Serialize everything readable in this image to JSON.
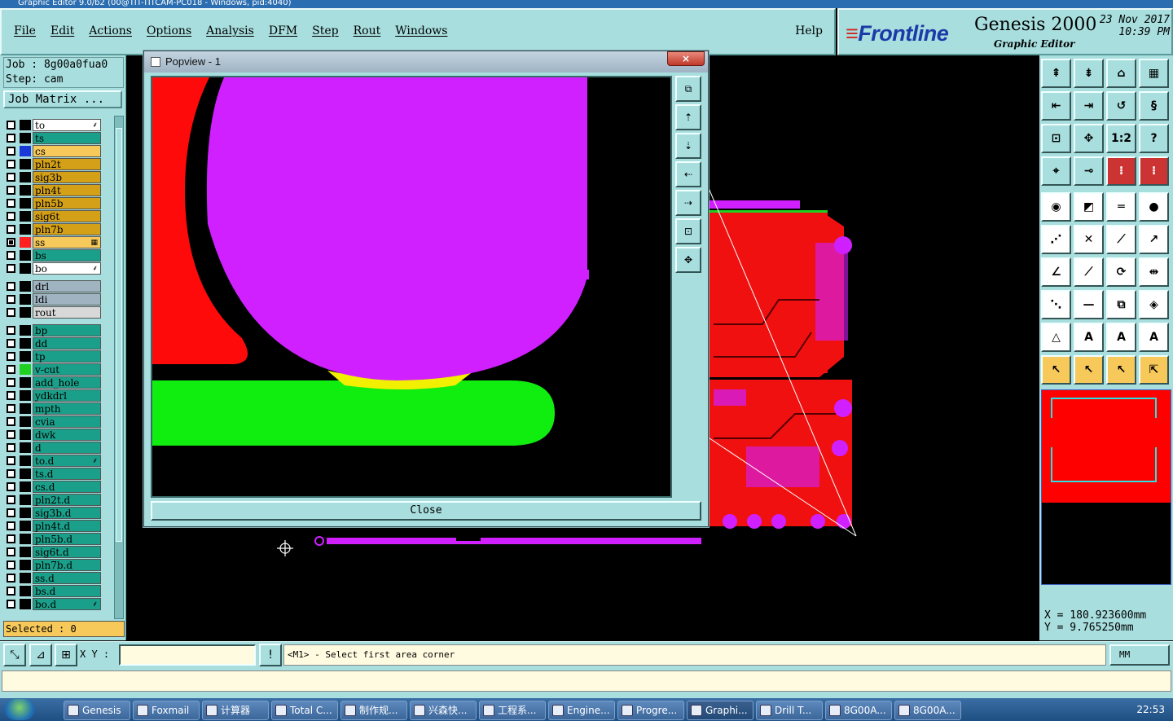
{
  "window": {
    "title": "Graphic Editor 9.0/b2 (00@TIT-TITCAM-PC018 - Windows, pid:4040)"
  },
  "menu": {
    "items": [
      "File",
      "Edit",
      "Actions",
      "Options",
      "Analysis",
      "DFM",
      "Step",
      "Rout",
      "Windows"
    ],
    "help": "Help"
  },
  "brand": {
    "logo": "Frontline",
    "product": "Genesis 2000",
    "subtitle": "Graphic Editor",
    "date": "23 Nov 2017",
    "time": "10:39 PM"
  },
  "job": {
    "job_line": "Job : 8g00a0fua0",
    "step_line": "Step: cam",
    "matrix_button": "Job Matrix ..."
  },
  "layers": [
    {
      "name": "to",
      "color": "#ffffff",
      "flag": "⸙",
      "checked": false,
      "mark": ""
    },
    {
      "name": "ts",
      "color": "#1aa08a",
      "flag": "",
      "checked": false,
      "mark": ""
    },
    {
      "name": "cs",
      "color": "#f7c95a",
      "flag": "",
      "checked": false,
      "mark": "#1a3ad8"
    },
    {
      "name": "pln2t",
      "color": "#d4a017",
      "flag": "",
      "checked": false,
      "mark": ""
    },
    {
      "name": "sig3b",
      "color": "#d4a017",
      "flag": "",
      "checked": false,
      "mark": ""
    },
    {
      "name": "pln4t",
      "color": "#d4a017",
      "flag": "",
      "checked": false,
      "mark": ""
    },
    {
      "name": "pln5b",
      "color": "#d4a017",
      "flag": "",
      "checked": false,
      "mark": ""
    },
    {
      "name": "sig6t",
      "color": "#d4a017",
      "flag": "",
      "checked": false,
      "mark": ""
    },
    {
      "name": "pln7b",
      "color": "#d4a017",
      "flag": "",
      "checked": false,
      "mark": ""
    },
    {
      "name": "ss",
      "color": "#f7c95a",
      "flag": "▦",
      "checked": true,
      "mark": "#ff2020"
    },
    {
      "name": "bs",
      "color": "#1aa08a",
      "flag": "",
      "checked": false,
      "mark": ""
    },
    {
      "name": "bo",
      "color": "#ffffff",
      "flag": "⸙",
      "checked": false,
      "mark": ""
    },
    {
      "name": "drl",
      "color": "#9fb4c0",
      "flag": "",
      "checked": false,
      "mark": ""
    },
    {
      "name": "ldi",
      "color": "#9fb4c0",
      "flag": "",
      "checked": false,
      "mark": ""
    },
    {
      "name": "rout",
      "color": "#d8d8d8",
      "flag": "",
      "checked": false,
      "mark": ""
    },
    {
      "name": "bp",
      "color": "#1aa08a",
      "flag": "",
      "checked": false,
      "mark": ""
    },
    {
      "name": "dd",
      "color": "#1aa08a",
      "flag": "",
      "checked": false,
      "mark": ""
    },
    {
      "name": "tp",
      "color": "#1aa08a",
      "flag": "",
      "checked": false,
      "mark": ""
    },
    {
      "name": "v-cut",
      "color": "#1aa08a",
      "flag": "",
      "checked": false,
      "mark": "#20d020"
    },
    {
      "name": "add_hole",
      "color": "#1aa08a",
      "flag": "",
      "checked": false,
      "mark": ""
    },
    {
      "name": "ydkdrl",
      "color": "#1aa08a",
      "flag": "",
      "checked": false,
      "mark": ""
    },
    {
      "name": "mpth",
      "color": "#1aa08a",
      "flag": "",
      "checked": false,
      "mark": ""
    },
    {
      "name": "cvia",
      "color": "#1aa08a",
      "flag": "",
      "checked": false,
      "mark": ""
    },
    {
      "name": "dwk",
      "color": "#1aa08a",
      "flag": "",
      "checked": false,
      "mark": ""
    },
    {
      "name": "d",
      "color": "#1aa08a",
      "flag": "",
      "checked": false,
      "mark": ""
    },
    {
      "name": "to.d",
      "color": "#1aa08a",
      "flag": "⸙",
      "checked": false,
      "mark": ""
    },
    {
      "name": "ts.d",
      "color": "#1aa08a",
      "flag": "",
      "checked": false,
      "mark": ""
    },
    {
      "name": "cs.d",
      "color": "#1aa08a",
      "flag": "",
      "checked": false,
      "mark": ""
    },
    {
      "name": "pln2t.d",
      "color": "#1aa08a",
      "flag": "",
      "checked": false,
      "mark": ""
    },
    {
      "name": "sig3b.d",
      "color": "#1aa08a",
      "flag": "",
      "checked": false,
      "mark": ""
    },
    {
      "name": "pln4t.d",
      "color": "#1aa08a",
      "flag": "",
      "checked": false,
      "mark": ""
    },
    {
      "name": "pln5b.d",
      "color": "#1aa08a",
      "flag": "",
      "checked": false,
      "mark": ""
    },
    {
      "name": "sig6t.d",
      "color": "#1aa08a",
      "flag": "",
      "checked": false,
      "mark": ""
    },
    {
      "name": "pln7b.d",
      "color": "#1aa08a",
      "flag": "",
      "checked": false,
      "mark": ""
    },
    {
      "name": "ss.d",
      "color": "#1aa08a",
      "flag": "",
      "checked": false,
      "mark": ""
    },
    {
      "name": "bs.d",
      "color": "#1aa08a",
      "flag": "",
      "checked": false,
      "mark": ""
    },
    {
      "name": "bo.d",
      "color": "#1aa08a",
      "flag": "⸙",
      "checked": false,
      "mark": ""
    }
  ],
  "selected": "Selected : 0",
  "popview": {
    "title": "Popview - 1",
    "close_label": "Close",
    "close_x": "×"
  },
  "command": {
    "xy_label": "X Y :",
    "xy_value": "",
    "prompt": "<M1> - Select first area corner",
    "units": "MM",
    "bang": "!"
  },
  "coords": {
    "x": "X = 180.923600mm",
    "y": "Y = 9.765250mm"
  },
  "tools": [
    "move-up",
    "move-down",
    "home",
    "window",
    "move-left",
    "move-right",
    "zoom-back",
    "redraw",
    "fit",
    "center",
    "scale-1-2",
    "help",
    "measure",
    "snap",
    "layer-a",
    "layer-b",
    "pad",
    "shape",
    "ruler",
    "circle",
    "nodes",
    "cross",
    "line-red",
    "arrow-red",
    "slash",
    "slash-blue",
    "rotate",
    "mirror",
    "move-dots",
    "line",
    "bracket",
    "shapes-blue",
    "tri",
    "tri-a",
    "tri-a2",
    "tri-a3",
    "cursor",
    "cursor-2",
    "cursor-3",
    "cursor-4"
  ],
  "taskbar": {
    "items": [
      "Genesis",
      "Foxmail",
      "计算器",
      "Total C...",
      "制作规...",
      "兴森快...",
      "工程系...",
      "Engine...",
      "Progre...",
      "Graphi...",
      "Drill T...",
      "8G00A...",
      "8G00A..."
    ],
    "clock": "22:53"
  }
}
